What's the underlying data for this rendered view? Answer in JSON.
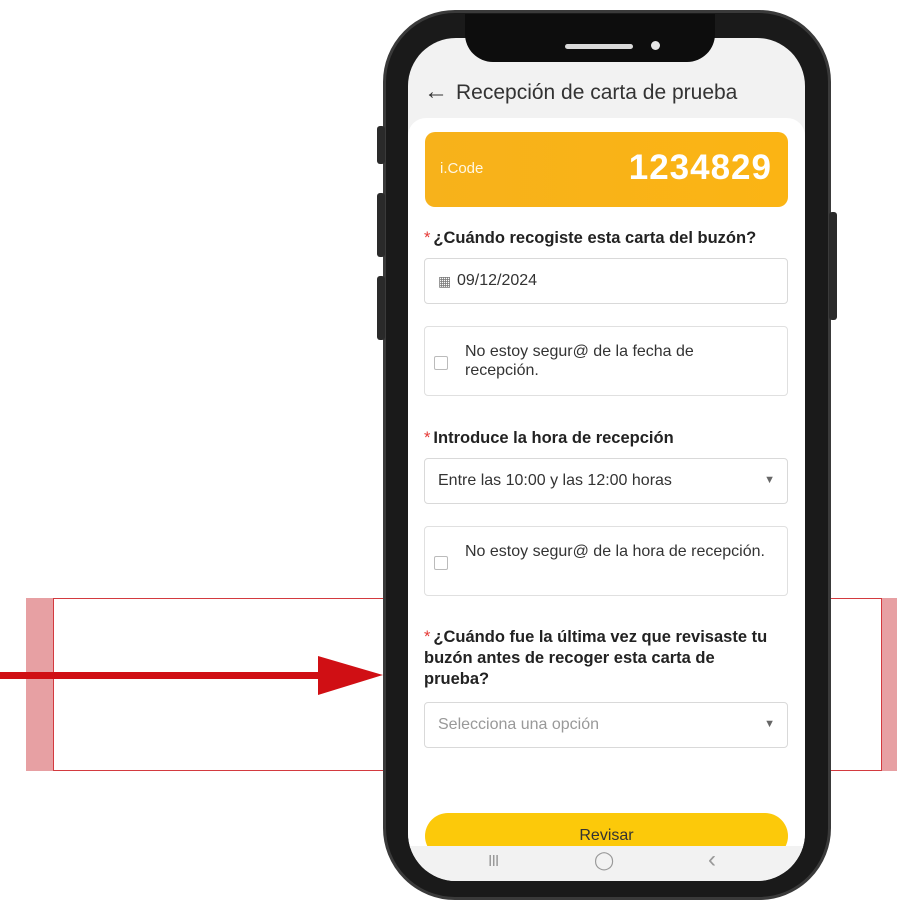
{
  "header": {
    "title": "Recepción de carta de prueba",
    "back_icon": "arrow-left-icon"
  },
  "icode": {
    "label": "i.Code",
    "value": "1234829"
  },
  "questions": [
    {
      "required_mark": "*",
      "label": "¿Cuándo recogiste esta carta del buzón?"
    },
    {
      "required_mark": "*",
      "label": "Introduce la hora de recepción"
    },
    {
      "required_mark": "*",
      "label": "¿Cuándo fue la última vez que revisaste tu buzón antes de recoger esta carta de prueba?"
    }
  ],
  "date_field": {
    "value": "09/12/2024"
  },
  "checkbox_date": {
    "label": "No estoy segur@ de la fecha de recepción."
  },
  "time_select": {
    "value": "Entre las 10:00 y las 12:00 horas"
  },
  "checkbox_time": {
    "label": "No estoy segur@ de la hora de recepción."
  },
  "last_check_select": {
    "placeholder": "Selecciona una opción"
  },
  "submit_button": {
    "label": "Revisar"
  },
  "android_nav": {
    "recents": "III",
    "home": "◯",
    "back": "‹"
  },
  "colors": {
    "icode_bg": "#fbb414",
    "button_bg": "#fcc90a",
    "highlight": "#d33a3f",
    "required": "#e53935"
  }
}
